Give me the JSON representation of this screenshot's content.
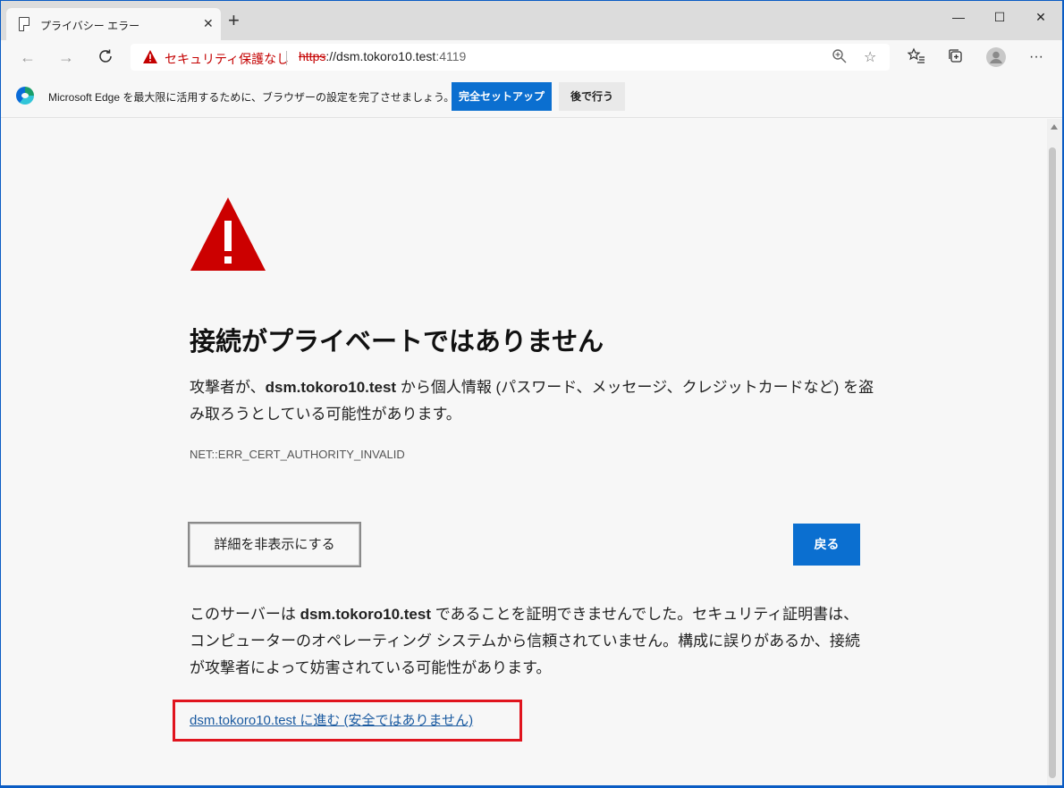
{
  "tab": {
    "title": "プライバシー エラー",
    "close": "✕",
    "new_tab": "+"
  },
  "window_controls": {
    "minimize": "—",
    "maximize": "☐",
    "close": "✕"
  },
  "address_bar": {
    "security_label": "セキュリティ保護なし",
    "url_scheme": "https",
    "url_sep": "://",
    "url_host": "dsm.tokoro10.test",
    "url_port": ":4119"
  },
  "banner": {
    "text": "Microsoft Edge を最大限に活用するために、ブラウザーの設定を完了させましょう。",
    "primary_button": "完全セットアップ",
    "secondary_button": "後で行う"
  },
  "page": {
    "heading": "接続がプライベートではありません",
    "desc_before": "攻撃者が、",
    "desc_host": "dsm.tokoro10.test",
    "desc_after": " から個人情報 (パスワード、メッセージ、クレジットカードなど) を盗み取ろうとしている可能性があります。",
    "error_code": "NET::ERR_CERT_AUTHORITY_INVALID",
    "details_button": "詳細を非表示にする",
    "back_button": "戻る",
    "para_before": "このサーバーは ",
    "para_host": "dsm.tokoro10.test",
    "para_after": " であることを証明できませんでした。セキュリティ証明書は、コンピューターのオペレーティング システムから信頼されていません。構成に誤りがあるか、接続が攻撃者によって妨害されている可能性があります。",
    "proceed_link": "dsm.tokoro10.test に進む (安全ではありません)"
  },
  "colors": {
    "accent": "#0b6fd0",
    "warning": "#c40000",
    "highlight_box": "#e0141e"
  }
}
